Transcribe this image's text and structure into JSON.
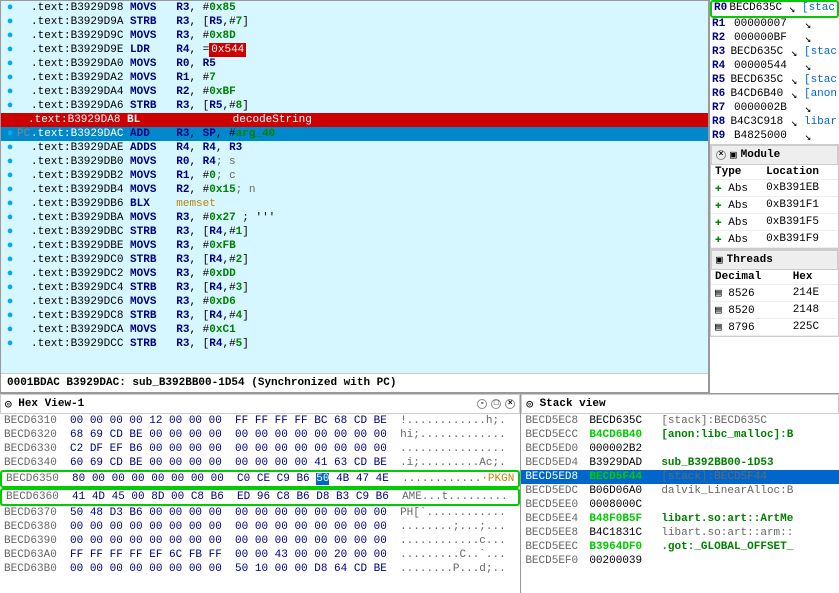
{
  "disasm": {
    "lines": [
      {
        "addr": ".text:B3929D98",
        "op": "MOVS",
        "args": "R3, #0x85"
      },
      {
        "addr": ".text:B3929D9A",
        "op": "STRB",
        "args": "R3, [R5,#7]"
      },
      {
        "addr": ".text:B3929D9C",
        "op": "MOVS",
        "args": "R3, #0x8D"
      },
      {
        "addr": ".text:B3929D9E",
        "op": "LDR",
        "args": "R4, =",
        "hl": "0x544"
      },
      {
        "addr": ".text:B3929DA0",
        "op": "MOVS",
        "args": "R0, R5"
      },
      {
        "addr": ".text:B3929DA2",
        "op": "MOVS",
        "args": "R1, #7"
      },
      {
        "addr": ".text:B3929DA4",
        "op": "MOVS",
        "args": "R2, #0xBF"
      },
      {
        "addr": ".text:B3929DA6",
        "op": "STRB",
        "args": "R3, [R5,#8]"
      },
      {
        "addr": ".text:B3929DA8",
        "op": "BL",
        "args": "decodeString",
        "bp": true,
        "cur": true
      },
      {
        "addr": ".text:B3929DAC",
        "op": "ADD",
        "args": "R3, SP, #arg_40",
        "sel": true
      },
      {
        "addr": ".text:B3929DAE",
        "op": "ADDS",
        "args": "R4, R4, R3"
      },
      {
        "addr": ".text:B3929DB0",
        "op": "MOVS",
        "args": "R0, R4",
        "cmt": "; s"
      },
      {
        "addr": ".text:B3929DB2",
        "op": "MOVS",
        "args": "R1, #0",
        "cmt": "; c"
      },
      {
        "addr": ".text:B3929DB4",
        "op": "MOVS",
        "args": "R2, #0x15",
        "cmt": "; n"
      },
      {
        "addr": ".text:B3929DB6",
        "op": "BLX",
        "args": "memset",
        "call": true
      },
      {
        "addr": ".text:B3929DBA",
        "op": "MOVS",
        "args": "R3, #0x27 ; '''"
      },
      {
        "addr": ".text:B3929DBC",
        "op": "STRB",
        "args": "R3, [R4,#1]"
      },
      {
        "addr": ".text:B3929DBE",
        "op": "MOVS",
        "args": "R3, #0xFB"
      },
      {
        "addr": ".text:B3929DC0",
        "op": "STRB",
        "args": "R3, [R4,#2]"
      },
      {
        "addr": ".text:B3929DC2",
        "op": "MOVS",
        "args": "R3, #0xDD"
      },
      {
        "addr": ".text:B3929DC4",
        "op": "STRB",
        "args": "R3, [R4,#3]"
      },
      {
        "addr": ".text:B3929DC6",
        "op": "MOVS",
        "args": "R3, #0xD6"
      },
      {
        "addr": ".text:B3929DC8",
        "op": "STRB",
        "args": "R3, [R4,#4]"
      },
      {
        "addr": ".text:B3929DCA",
        "op": "MOVS",
        "args": "R3, #0xC1"
      },
      {
        "addr": ".text:B3929DCC",
        "op": "STRB",
        "args": "R3, [R4,#5]"
      }
    ],
    "status": "0001BDAC  B3929DAC: sub_B392BB00-1D54  (Synchronized with PC)"
  },
  "regs": [
    {
      "n": "R0",
      "v": "BECD635C",
      "l": "[stac",
      "hl": true
    },
    {
      "n": "R1",
      "v": "00000007"
    },
    {
      "n": "R2",
      "v": "000000BF"
    },
    {
      "n": "R3",
      "v": "BECD635C",
      "l": "[stac"
    },
    {
      "n": "R4",
      "v": "00000544"
    },
    {
      "n": "R5",
      "v": "BECD635C",
      "l": "[stac"
    },
    {
      "n": "R6",
      "v": "B4CD6B40",
      "l": "[anon"
    },
    {
      "n": "R7",
      "v": "0000002B"
    },
    {
      "n": "R8",
      "v": "B4C3C918",
      "l": "libar"
    },
    {
      "n": "R9",
      "v": "B4825000"
    }
  ],
  "modules": {
    "title": "Module",
    "cols": [
      "Type",
      "Location"
    ],
    "rows": [
      {
        "t": "Abs",
        "l": "0xB391EB"
      },
      {
        "t": "Abs",
        "l": "0xB391F1"
      },
      {
        "t": "Abs",
        "l": "0xB391F5"
      },
      {
        "t": "Abs",
        "l": "0xB391F9"
      }
    ]
  },
  "threads": {
    "title": "Threads",
    "cols": [
      "Decimal",
      "Hex"
    ],
    "rows": [
      {
        "d": "8526",
        "h": "214E"
      },
      {
        "d": "8520",
        "h": "2148"
      },
      {
        "d": "8796",
        "h": "225C"
      }
    ]
  },
  "hexview": {
    "title": "Hex View-1",
    "lines": [
      {
        "a": "BECD6310",
        "b": "00 00 00 00 12 00 00 00  FF FF FF FF BC 68 CD BE",
        "t": "!............h;."
      },
      {
        "a": "BECD6320",
        "b": "68 69 CD BE 00 00 00 00  00 00 00 00 00 00 00 00",
        "t": "hi;............."
      },
      {
        "a": "BECD6330",
        "b": "C2 DF EF B6 00 00 00 00  00 00 00 00 00 00 00 00",
        "t": "................"
      },
      {
        "a": "BECD6340",
        "b": "60 69 CD BE 00 00 00 00  00 00 00 00 41 63 CD BE",
        "t": ".i;.........Ac;."
      },
      {
        "a": "BECD6350",
        "b": "80 00 00 00 00 00 00 00  C0 CE C9 B6 ",
        "b2": "50",
        "b3": " 4B 47 4E",
        "t": "............",
        "ty": "·PKGN",
        "box": true
      },
      {
        "a": "BECD6360",
        "b": "41 4D 45 00 8D 00 C8 B6  ED 96 C8 B6 D8 B3 C9 B6",
        "t": "AME...t.........",
        "box": true
      },
      {
        "a": "BECD6370",
        "b": "50 48 D3 B6 00 00 00 00  00 00 00 00 00 00 00 00",
        "t": "PH[`............"
      },
      {
        "a": "BECD6380",
        "b": "00 00 00 00 00 00 00 00  00 00 00 00 00 00 00 00",
        "t": "........;...;..."
      },
      {
        "a": "BECD6390",
        "b": "00 00 00 00 00 00 00 00  00 00 00 00 00 00 00 00",
        "t": "............c..."
      },
      {
        "a": "BECD63A0",
        "b": "FF FF FF FF EF 6C FB FF  00 00 43 00 00 20 00 00",
        "t": ".........C..`..."
      },
      {
        "a": "BECD63B0",
        "b": "00 00 00 00 00 00 00 00  50 10 00 00 D8 64 CD BE",
        "t": "........P...d;.."
      }
    ]
  },
  "stack": {
    "title": "Stack view",
    "lines": [
      {
        "a": "BECD5EC8",
        "v": "BECD635C",
        "d": "[stack]:BECD635C"
      },
      {
        "a": "BECD5ECC",
        "v": "B4CD6B40",
        "d": "[anon:libc_malloc]:B",
        "g": true
      },
      {
        "a": "BECD5ED0",
        "v": "000002B2"
      },
      {
        "a": "BECD5ED4",
        "v": "B3929DAD",
        "d": "sub_B392BB00-1D53",
        "sub": true
      },
      {
        "a": "BECD5ED8",
        "v": "BECD5F44",
        "d": "[stack]:BECD5F44",
        "sel": true
      },
      {
        "a": "BECD5EDC",
        "v": "B06D06A0",
        "d": "dalvik_LinearAlloc:B"
      },
      {
        "a": "BECD5EE0",
        "v": "0008000C"
      },
      {
        "a": "BECD5EE4",
        "v": "B48F0B5F",
        "d": "libart.so:art::ArtMe",
        "g": true
      },
      {
        "a": "BECD5EE8",
        "v": "B4C1831C",
        "d": "libart.so:art::arm::"
      },
      {
        "a": "BECD5EEC",
        "v": "B3964DF0",
        "d": ".got:_GLOBAL_OFFSET_",
        "g": true
      },
      {
        "a": "BECD5EF0",
        "v": "00200039"
      }
    ]
  }
}
